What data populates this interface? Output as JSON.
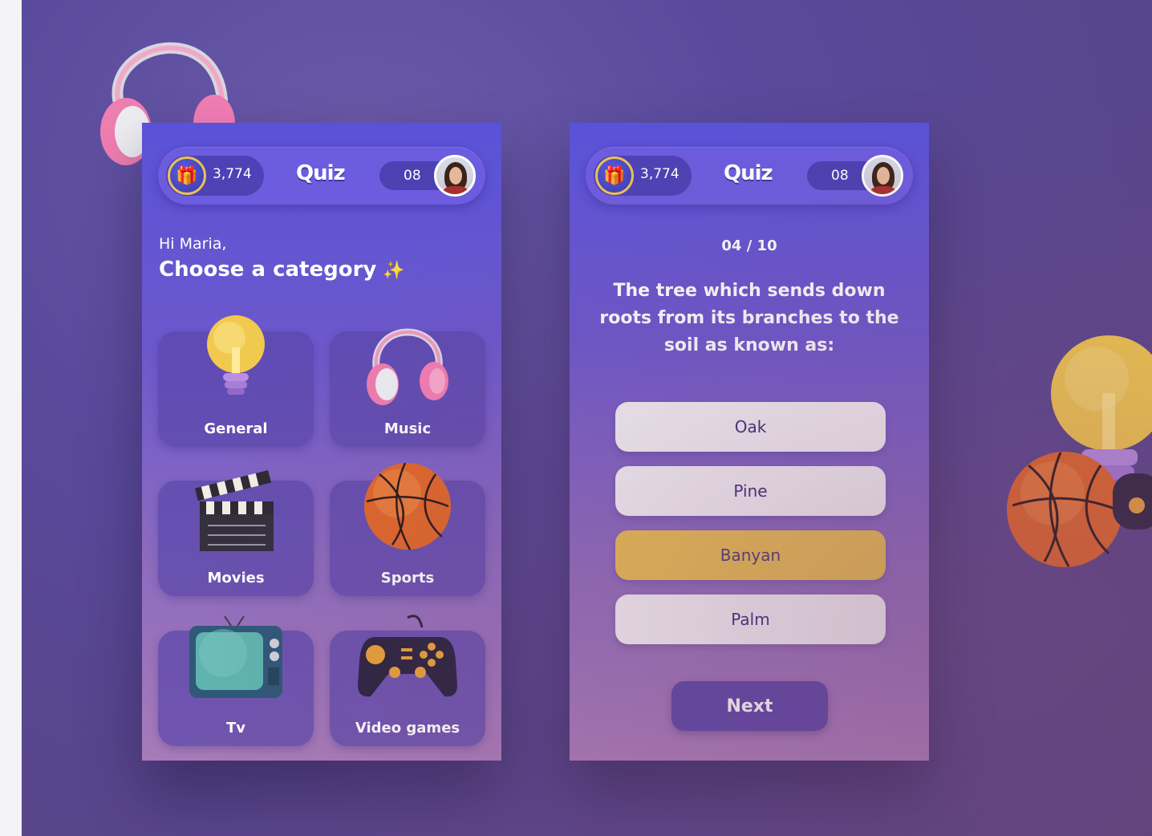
{
  "header": {
    "coins": "3,774",
    "logo": "Quiz",
    "level": "08"
  },
  "category_screen": {
    "greeting": "Hi Maria,",
    "heading": "Choose a category",
    "categories": [
      {
        "label": "General",
        "icon": "lightbulb-icon"
      },
      {
        "label": "Music",
        "icon": "headphones-icon"
      },
      {
        "label": "Movies",
        "icon": "clapperboard-icon"
      },
      {
        "label": "Sports",
        "icon": "basketball-icon"
      },
      {
        "label": "Tv",
        "icon": "tv-icon"
      },
      {
        "label": "Video games",
        "icon": "gamepad-icon"
      }
    ]
  },
  "question_screen": {
    "progress": "04 / 10",
    "question": "The tree which sends down roots from its branches to the soil as known as:",
    "answers": [
      {
        "label": "Oak",
        "selected": false
      },
      {
        "label": "Pine",
        "selected": false
      },
      {
        "label": "Banyan",
        "selected": true
      },
      {
        "label": "Palm",
        "selected": false
      }
    ],
    "next_label": "Next"
  },
  "colors": {
    "accent_yellow": "#e8bf52",
    "screen_top": "#5a52d8",
    "screen_bottom": "#a87bb8",
    "button_purple": "#5c46a8"
  }
}
